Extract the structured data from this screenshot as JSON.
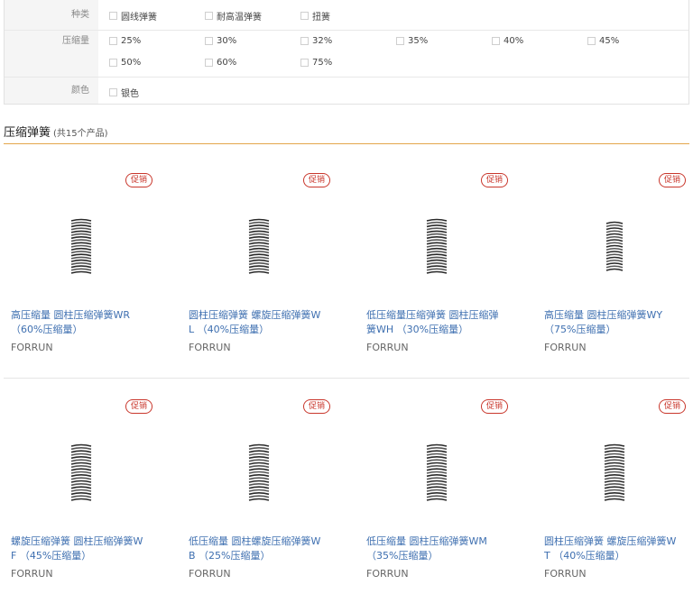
{
  "filters": {
    "type": {
      "label": "种类",
      "options": [
        "圆线弹簧",
        "耐高温弹簧",
        "扭簧"
      ]
    },
    "compression": {
      "label": "压缩量",
      "options": [
        "25%",
        "30%",
        "32%",
        "35%",
        "40%",
        "45%",
        "50%",
        "60%",
        "75%"
      ]
    },
    "color": {
      "label": "颜色",
      "options": [
        "银色"
      ]
    }
  },
  "section": {
    "title": "压缩弹簧",
    "count": "(共15个产品)"
  },
  "products": [
    {
      "badge": "促销",
      "name_line1": "高压缩量 圆柱压缩弹簧WR",
      "name_line2": "（60%压缩量）",
      "brand": "FORRUN"
    },
    {
      "badge": "促销",
      "name_line1": "圆柱压缩弹簧 螺旋压缩弹簧W",
      "name_line2": "L （40%压缩量）",
      "brand": "FORRUN"
    },
    {
      "badge": "促销",
      "name_line1": "低压缩量压缩弹簧 圆柱压缩弹",
      "name_line2": "簧WH （30%压缩量）",
      "brand": "FORRUN"
    },
    {
      "badge": "促销",
      "name_line1": "高压缩量 圆柱压缩弹簧WY",
      "name_line2": "（75%压缩量）",
      "brand": "FORRUN"
    },
    {
      "badge": "促销",
      "name_line1": "螺旋压缩弹簧 圆柱压缩弹簧W",
      "name_line2": "F （45%压缩量）",
      "brand": "FORRUN"
    },
    {
      "badge": "促销",
      "name_line1": "低压缩量 圆柱螺旋压缩弹簧W",
      "name_line2": "B （25%压缩量）",
      "brand": "FORRUN"
    },
    {
      "badge": "促销",
      "name_line1": "低压缩量 圆柱压缩弹簧WM",
      "name_line2": "（35%压缩量）",
      "brand": "FORRUN"
    },
    {
      "badge": "促销",
      "name_line1": "圆柱压缩弹簧 螺旋压缩弹簧W",
      "name_line2": "T （40%压缩量）",
      "brand": "FORRUN"
    }
  ],
  "colors": {
    "accent_line": "#e3a64b",
    "badge": "#c9372c",
    "link": "#3e6fb0"
  }
}
